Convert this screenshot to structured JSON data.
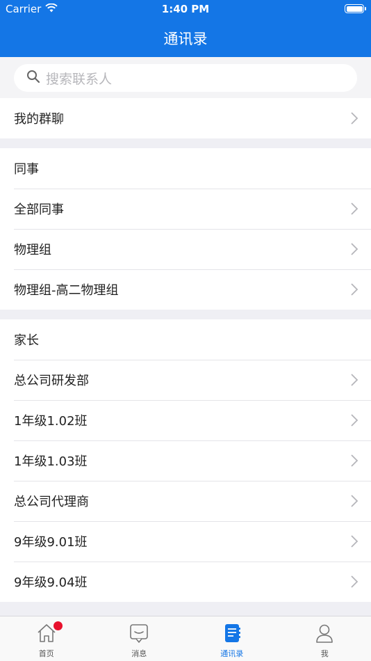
{
  "status_bar": {
    "carrier": "Carrier",
    "time": "1:40 PM"
  },
  "nav": {
    "title": "通讯录"
  },
  "search": {
    "placeholder": "搜索联系人"
  },
  "groups_entry": {
    "label": "我的群聊"
  },
  "colleagues": {
    "header": "同事",
    "items": [
      {
        "label": "全部同事"
      },
      {
        "label": "物理组"
      },
      {
        "label": "物理组-高二物理组"
      }
    ]
  },
  "parents": {
    "header": "家长",
    "items": [
      {
        "label": "总公司研发部"
      },
      {
        "label": "1年级1.02班"
      },
      {
        "label": "1年级1.03班"
      },
      {
        "label": "总公司代理商"
      },
      {
        "label": "9年级9.01班"
      },
      {
        "label": "9年级9.04班"
      }
    ]
  },
  "tabbar": {
    "tabs": [
      {
        "label": "首页",
        "icon": "home-icon",
        "has_badge": true
      },
      {
        "label": "消息",
        "icon": "message-icon"
      },
      {
        "label": "通讯录",
        "icon": "contacts-book-icon",
        "active": true
      },
      {
        "label": "我",
        "icon": "person-icon"
      }
    ]
  },
  "colors": {
    "accent": "#1476e6",
    "badge": "#e8112d"
  }
}
